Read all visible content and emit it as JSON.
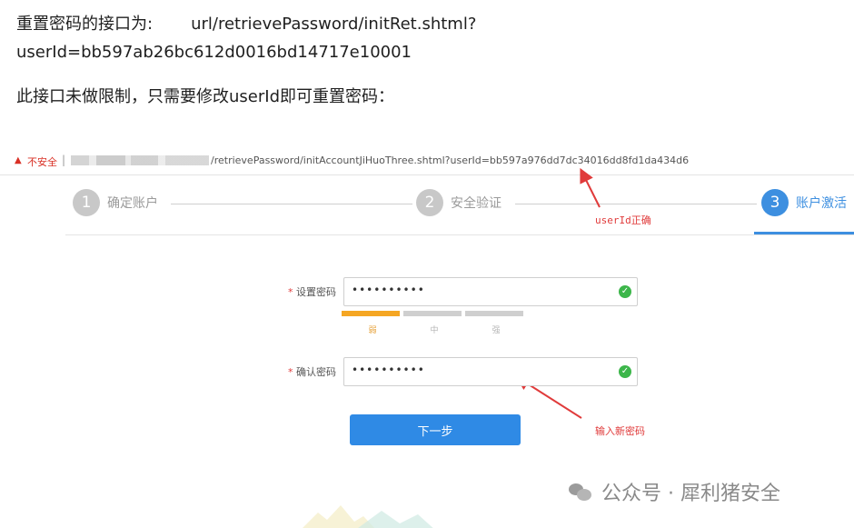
{
  "intro": {
    "line1_prefix": "重置密码的接口为:",
    "line1_url": "url/retrievePassword/initRet.shtml?",
    "line2": "userId=bb597ab26bc612d0016bd14717e10001",
    "line3": "此接口未做限制，只需要修改userId即可重置密码："
  },
  "address_bar": {
    "insecure_label": "不安全",
    "separator": "|",
    "url_path": "/retrievePassword/initAccountJiHuoThree.shtml?userId=bb597a976dd7dc34016dd8fd1da434d6"
  },
  "steps": [
    {
      "number": "1",
      "label": "确定账户",
      "active": false
    },
    {
      "number": "2",
      "label": "安全验证",
      "active": false
    },
    {
      "number": "3",
      "label": "账户激活",
      "active": true
    }
  ],
  "annotations": {
    "userid_ok": "userId正确",
    "enter_new_password": "输入新密码"
  },
  "form": {
    "password": {
      "label": "设置密码",
      "required_mark": "*",
      "value": "••••••••••"
    },
    "strength": {
      "levels": [
        "弱",
        "中",
        "强"
      ],
      "current_level": 1,
      "max_level": 3
    },
    "confirm": {
      "label": "确认密码",
      "required_mark": "*",
      "value": "••••••••••"
    },
    "check_glyph": "✓",
    "next_button": "下一步"
  },
  "watermark": {
    "text": "公众号 · 犀利猪安全"
  },
  "colors": {
    "accent": "#3d8fe0",
    "annotation": "#e03b3b",
    "weak": "#f5a623",
    "ok": "#3cb64a"
  }
}
